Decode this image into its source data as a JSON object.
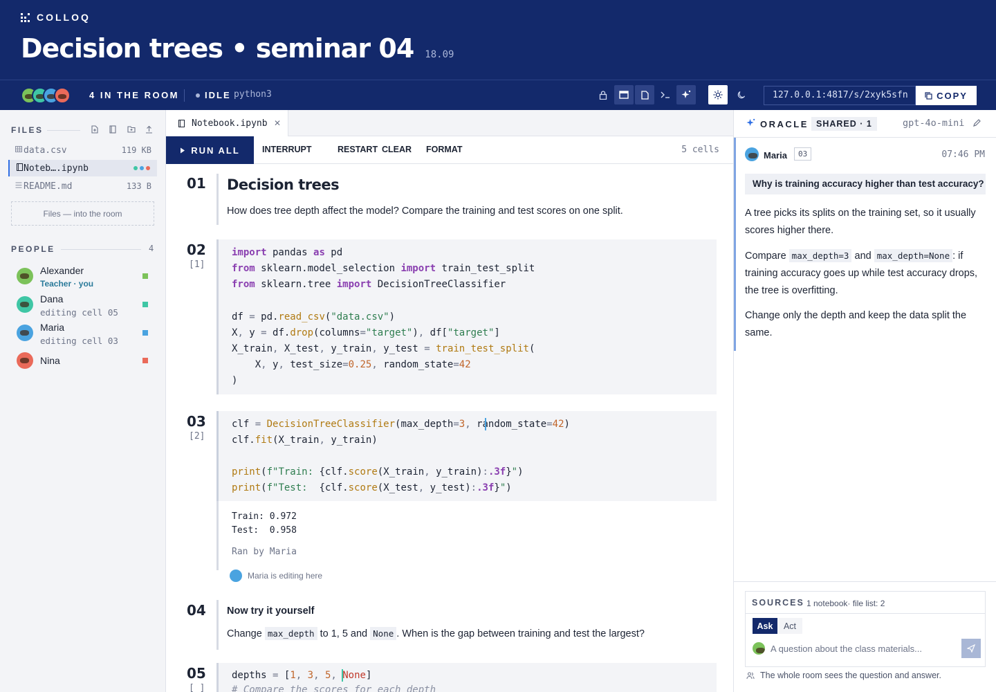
{
  "brand": "COLLOQ",
  "header": {
    "title": "Decision trees • seminar 04",
    "date": "18.09"
  },
  "toolbar": {
    "room_count": "4 IN THE ROOM",
    "status": "IDLE",
    "kernel": "python3",
    "url": "127.0.0.1:4817/s/2xyk5sfn",
    "copy_label": "COPY"
  },
  "sidebar": {
    "files_heading": "FILES",
    "files": [
      {
        "name": "data.csv",
        "size": "119 KB",
        "icon": "table-icon"
      },
      {
        "name": "Noteb….ipynb",
        "icon": "notebook-icon"
      },
      {
        "name": "README.md",
        "size": "133 B",
        "icon": "text-icon"
      }
    ],
    "drop_hint": "Files — into the room",
    "people_heading": "PEOPLE",
    "people_count": "4",
    "people": [
      {
        "name": "Alexander",
        "sub": "Teacher · you",
        "color": "#7cc25a"
      },
      {
        "name": "Dana",
        "sub": "editing cell 05",
        "color": "#3fc6a5"
      },
      {
        "name": "Maria",
        "sub": "editing cell 03",
        "color": "#4aa3e0"
      },
      {
        "name": "Nina",
        "color": "#ea6a5a"
      }
    ]
  },
  "notebook": {
    "tab_label": "Notebook.ipynb",
    "run_all": "RUN ALL",
    "actions": [
      "INTERRUPT",
      "RESTART",
      "CLEAR",
      "FORMAT"
    ],
    "cell_count": "5 cells",
    "cells": {
      "c1": {
        "num": "01",
        "title": "Decision trees",
        "text": "How does tree depth affect the model? Compare the training and test scores on one split."
      },
      "c2": {
        "num": "02",
        "exec": "[1]"
      },
      "c3": {
        "num": "03",
        "exec": "[2]",
        "output": [
          "Train: 0.972",
          "Test:  0.958"
        ],
        "ran_by": "Ran by Maria",
        "editing": "Maria is editing here"
      },
      "c4": {
        "num": "04",
        "title": "Now try it yourself",
        "text_a": "Change",
        "code_a": "max_depth",
        "text_b": "to 1, 5 and",
        "code_b": "None",
        "text_c": ". When is the gap between training and test the largest?"
      },
      "c5": {
        "num": "05",
        "exec": "[ ]"
      }
    }
  },
  "oracle": {
    "title": "ORACLE",
    "badge": "SHARED · 1",
    "model": "gpt-4o-mini",
    "message": {
      "author": "Maria",
      "cell": "03",
      "time": "07:46 PM",
      "question": "Why is training accuracy higher than test accuracy?",
      "p1": "A tree picks its splits on the training set, so it usually scores higher there.",
      "p2_a": "Compare",
      "p2_code1": "max_depth=3",
      "p2_b": "and",
      "p2_code2": "max_depth=None",
      "p2_c": ": if training accuracy goes up while test accuracy drops, the tree is overfitting.",
      "p3": "Change only the depth and keep the data split the same."
    },
    "sources_heading": "SOURCES",
    "sources_value": "1 notebook· file list: 2",
    "mode_ask": "Ask",
    "mode_act": "Act",
    "placeholder": "A question about the class materials...",
    "note": "The whole room sees the question and answer."
  },
  "colors": {
    "navy": "#13296b",
    "accent_blue": "#2f6fe4",
    "keyword": "#8a3fb0",
    "string": "#2e7d4f",
    "number": "#c0652a"
  }
}
